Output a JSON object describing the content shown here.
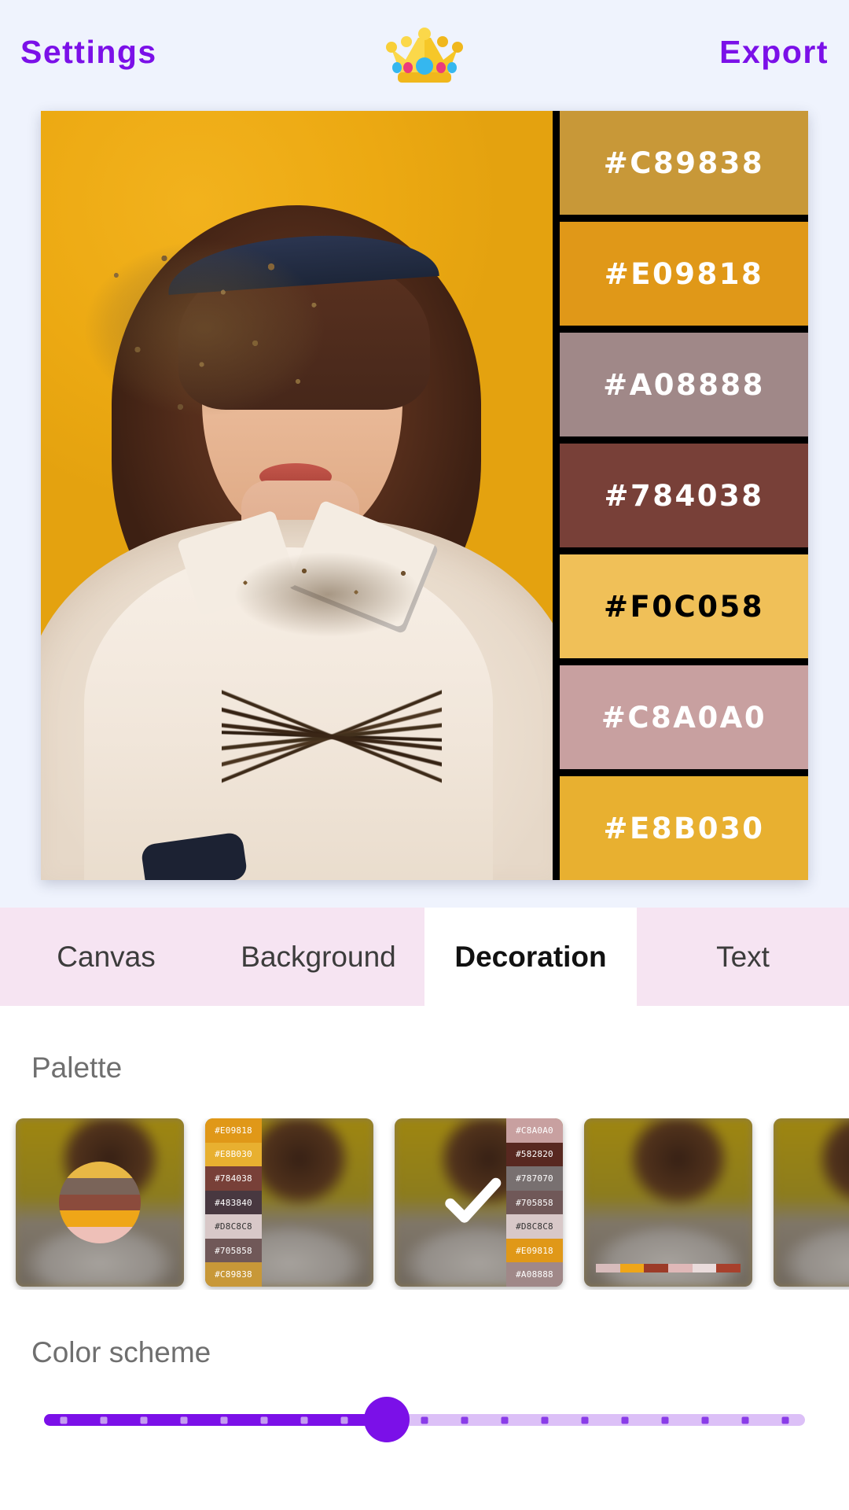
{
  "header": {
    "left_button": "Settings",
    "right_button": "Export",
    "logo_icon": "crown-icon"
  },
  "canvas": {
    "photo_alt": "woman-with-dried-flowers-on-yellow-background",
    "swatches": [
      {
        "hex": "#C89838",
        "bg": "#C89838",
        "text": "#FFFFFF"
      },
      {
        "hex": "#E09818",
        "bg": "#E09818",
        "text": "#FFFFFF"
      },
      {
        "hex": "#A08888",
        "bg": "#A08888",
        "text": "#FFFFFF"
      },
      {
        "hex": "#784038",
        "bg": "#784038",
        "text": "#FFFFFF"
      },
      {
        "hex": "#F0C058",
        "bg": "#F0C058",
        "text": "#000000"
      },
      {
        "hex": "#C8A0A0",
        "bg": "#C8A0A0",
        "text": "#FFFFFF"
      },
      {
        "hex": "#E8B030",
        "bg": "#E8B030",
        "text": "#FFFFFF"
      }
    ]
  },
  "tabs": [
    {
      "label": "Canvas",
      "active": false
    },
    {
      "label": "Background",
      "active": false
    },
    {
      "label": "Decoration",
      "active": true
    },
    {
      "label": "Text",
      "active": false
    }
  ],
  "sections": {
    "palette_label": "Palette",
    "color_scheme_label": "Color scheme"
  },
  "palette_cards": [
    {
      "layout": "circle",
      "selected": false,
      "colors": [
        "#E8B845",
        "#7A6459",
        "#8B4B3C",
        "#EFA618",
        "#EEC0B8"
      ]
    },
    {
      "layout": "strip-left",
      "selected": false,
      "colors": [
        {
          "hex": "#E09818",
          "bg": "#E09818",
          "text": "#FFFFFF"
        },
        {
          "hex": "#E8B030",
          "bg": "#E8B030",
          "text": "#FFFFFF"
        },
        {
          "hex": "#784038",
          "bg": "#784038",
          "text": "#FFFFFF"
        },
        {
          "hex": "#483840",
          "bg": "#483840",
          "text": "#FFFFFF"
        },
        {
          "hex": "#D8C8C8",
          "bg": "#D8C8C8",
          "text": "#333333"
        },
        {
          "hex": "#705858",
          "bg": "#705858",
          "text": "#FFFFFF"
        },
        {
          "hex": "#C89838",
          "bg": "#C89838",
          "text": "#FFFFFF"
        }
      ]
    },
    {
      "layout": "strip-right",
      "selected": true,
      "colors": [
        {
          "hex": "#C8A0A0",
          "bg": "#C8A0A0",
          "text": "#FFFFFF"
        },
        {
          "hex": "#582820",
          "bg": "#582820",
          "text": "#FFFFFF"
        },
        {
          "hex": "#787070",
          "bg": "#787070",
          "text": "#FFFFFF"
        },
        {
          "hex": "#705858",
          "bg": "#705858",
          "text": "#FFFFFF"
        },
        {
          "hex": "#D8C8C8",
          "bg": "#D8C8C8",
          "text": "#333333"
        },
        {
          "hex": "#E09818",
          "bg": "#E09818",
          "text": "#FFFFFF"
        },
        {
          "hex": "#A08888",
          "bg": "#A08888",
          "text": "#FFFFFF"
        }
      ]
    },
    {
      "layout": "bar-bottom",
      "selected": false,
      "colors": [
        "#D8BCBC",
        "#EFA618",
        "#9C3B28",
        "#E0B8B8",
        "#EADCDC",
        "#A8402C"
      ]
    },
    {
      "layout": "plain",
      "selected": false,
      "colors": []
    }
  ],
  "color_scheme_slider": {
    "value_percent": 45,
    "tick_count": 19,
    "accent": "#7B10E8",
    "track": "#DCC0F7"
  }
}
